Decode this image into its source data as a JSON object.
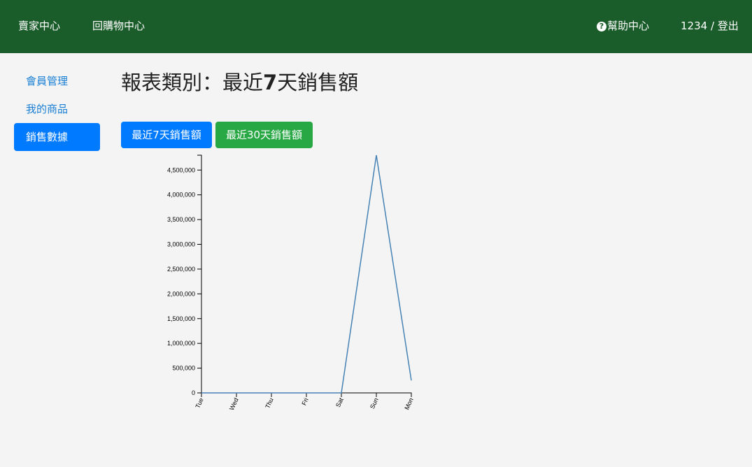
{
  "navbar": {
    "seller_center": "賣家中心",
    "back_to_shopping": "回購物中心",
    "help_center": "幫助中心",
    "help_icon": "question-circle-icon",
    "user_logout": "1234 / 登出",
    "background_color": "#1a5c2a"
  },
  "sidebar": {
    "items": [
      {
        "label": "會員管理",
        "active": false
      },
      {
        "label": "我的商品",
        "active": false
      },
      {
        "label": "銷售數據",
        "active": true
      }
    ]
  },
  "main": {
    "title_prefix": "報表類別：最近",
    "title_number": "7",
    "title_suffix": "天銷售額",
    "buttons": {
      "last7": "最近7天銷售額",
      "last30": "最近30天銷售額"
    }
  },
  "chart_data": {
    "type": "line",
    "categories": [
      "Tue",
      "Wed",
      "Thu",
      "Fri",
      "Sat",
      "Sun",
      "Mon"
    ],
    "series": [
      {
        "values": [
          0,
          0,
          0,
          0,
          0,
          4800000,
          250000
        ],
        "color": "#4682b4"
      }
    ],
    "y_ticks": [
      "0",
      "500,000",
      "1,000,000",
      "1,500,000",
      "2,000,000",
      "2,500,000",
      "3,000,000",
      "3,500,000",
      "4,000,000",
      "4,500,000"
    ],
    "y_tick_values": [
      0,
      500000,
      1000000,
      1500000,
      2000000,
      2500000,
      3000000,
      3500000,
      4000000,
      4500000
    ],
    "ylim": [
      0,
      4800000
    ],
    "grid": false,
    "title": "",
    "xlabel": "",
    "ylabel": ""
  }
}
